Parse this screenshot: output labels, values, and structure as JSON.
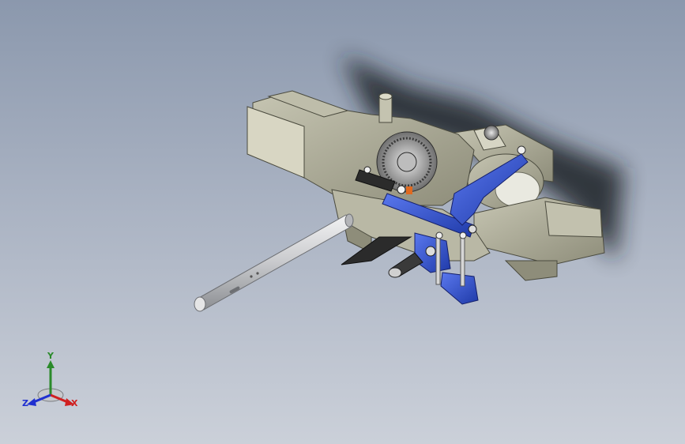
{
  "viewport": {
    "background_top": "#8b98ad",
    "background_bottom": "#cbd0d9"
  },
  "model": {
    "part_color_body": "#a9a894",
    "part_color_blue": "#2f4fd0",
    "part_color_shaft": "#d9dadc",
    "part_color_dark": "#2b2b2b"
  },
  "triad": {
    "y_label": "Y",
    "x_label": "X",
    "z_label": "Z",
    "y_color": "#2a8a2a",
    "x_color": "#d02020",
    "z_color": "#2030d0"
  }
}
